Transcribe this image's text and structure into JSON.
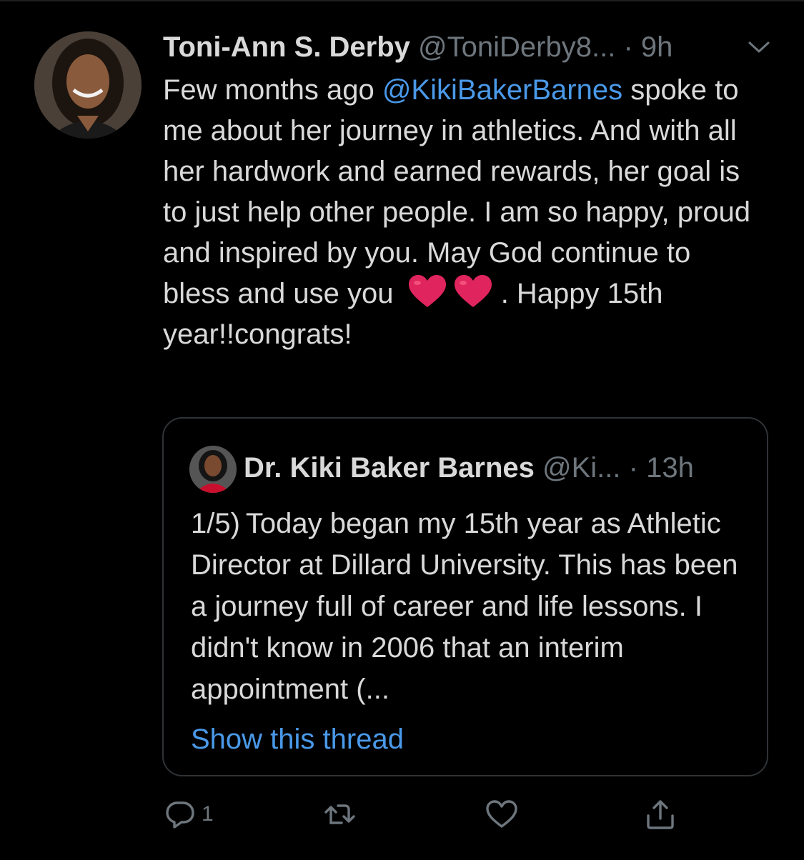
{
  "tweet": {
    "display_name": "Toni-Ann S. Derby",
    "handle": "@ToniDerby8...",
    "separator": "·",
    "time": "9h",
    "text_before_mention": "Few months ago ",
    "mention": "@KikiBakerBarnes",
    "text_body": " spoke to me about her journey in athletics. And with all her hardwork and earned rewards, her goal is to just help other people. I am so happy, proud and inspired by you. May God continue to bless and use you",
    "text_after_emoji": " . Happy 15th year!!congrats!",
    "emoji": [
      "red-heart",
      "red-heart"
    ]
  },
  "quoted_tweet": {
    "display_name": "Dr. Kiki Baker Barnes",
    "handle": "@Ki...",
    "separator": "·",
    "time": "13h",
    "text": "1/5) Today began my 15th year as Athletic Director at Dillard University. This has been a journey full of career and life lessons.  I didn't know in 2006 that an interim appointment (...",
    "show_thread_label": "Show this thread"
  },
  "actions": {
    "reply_count": "1",
    "retweet_count": "",
    "like_count": ""
  },
  "colors": {
    "background": "#000000",
    "text": "#d9d9d9",
    "secondary": "#6e767d",
    "link": "#4a99e9",
    "border": "#2f3336",
    "heart": "#e0245e"
  },
  "icons": [
    "chevron-down-icon",
    "reply-icon",
    "retweet-icon",
    "like-icon",
    "share-icon"
  ]
}
